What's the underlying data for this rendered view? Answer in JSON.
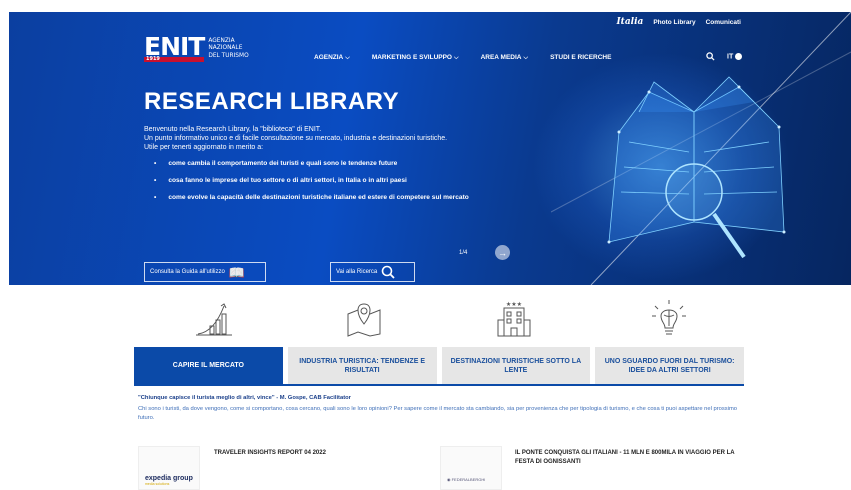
{
  "topbar": {
    "italia": "Italia",
    "photo_library": "Photo Library",
    "comunicati": "Comunicati"
  },
  "logo": {
    "mark": "ENIT",
    "year": "1919",
    "line1": "AGENZIA",
    "line2": "NAZIONALE",
    "line3": "DEL TURISMO"
  },
  "nav": {
    "items": [
      "AGENZIA",
      "MARKETING E SVILUPPO",
      "AREA MEDIA",
      "STUDI E RICERCHE"
    ],
    "lang": "IT"
  },
  "hero": {
    "title": "RESEARCH LIBRARY",
    "intro_1": "Benvenuto nella Research Library, la \"biblioteca\" di ENIT.",
    "intro_2": "Un punto informativo unico e di facile consultazione su mercato, industria e destinazioni turistiche.",
    "intro_3": "Utile per tenerti aggiornato in merito a:",
    "bullets": [
      "come cambia il comportamento dei turisti e quali sono le tendenze future",
      "cosa fanno le imprese del tuo settore o di altri settori, in Italia o in altri paesi",
      "come evolve la capacità delle destinazioni turistiche italiane ed estere di competere sul mercato"
    ],
    "btn_guide": "Consulta la Guida all'utilizzo",
    "btn_search": "Vai alla Ricerca",
    "pager": "1/4"
  },
  "tabs": [
    {
      "label": "CAPIRE IL MERCATO"
    },
    {
      "label": "INDUSTRIA TURISTICA: TENDENZE E RISULTATI"
    },
    {
      "label": "DESTINAZIONI TURISTICHE SOTTO LA LENTE"
    },
    {
      "label": "UNO SGUARDO FUORI DAL TURISMO: IDEE DA ALTRI SETTORI"
    }
  ],
  "content": {
    "quote": "\"Chiunque capisce il turista meglio di altri, vince\" - M. Gospe, CAB Facilitator",
    "desc": "Chi sono i turisti, da dove vengono, come si comportano, cosa cercano, quali sono le loro opinioni? Per sapere come il mercato sta cambiando, sia per provenienza che per tipologia di turismo, e che cosa ti puoi aspettare nel prossimo futuro.",
    "card1_title": "TRAVELER INSIGHTS REPORT 04 2022",
    "card1_brand": "expedia group",
    "card1_sub": "media solutions",
    "card2_title": "IL PONTE CONQUISTA GLI ITALIANI - 11 MLN E 800MILA IN VIAGGIO PER LA FESTA DI OGNISSANTI",
    "card2_brand": "FEDERALBERGHI"
  },
  "colors": {
    "primary": "#0b4aa8",
    "tab_bg": "#e6e6e6",
    "accent_red": "#c8102e"
  }
}
